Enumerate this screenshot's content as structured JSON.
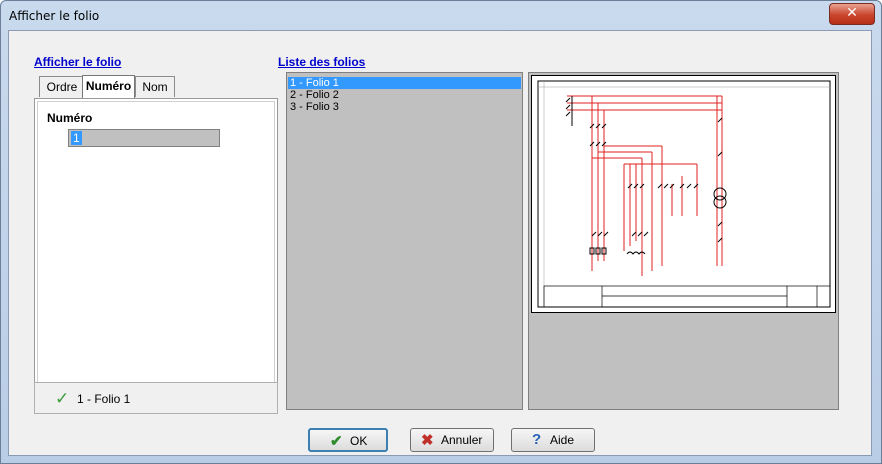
{
  "window": {
    "title": "Afficher le folio",
    "close_glyph": "✕"
  },
  "left": {
    "section_title": "Afficher le folio",
    "tabs": [
      {
        "label": "Ordre"
      },
      {
        "label": "Numéro"
      },
      {
        "label": "Nom"
      }
    ],
    "field_label": "Numéro",
    "field_value": "1",
    "status_text": "1 - Folio 1",
    "status_icon": "check-icon"
  },
  "list": {
    "section_title": "Liste des folios",
    "items": [
      {
        "label": "1 - Folio 1",
        "selected": true
      },
      {
        "label": "2 - Folio 2",
        "selected": false
      },
      {
        "label": "3 - Folio 3",
        "selected": false
      }
    ]
  },
  "buttons": {
    "ok": "OK",
    "cancel": "Annuler",
    "help": "Aide"
  },
  "colors": {
    "selection": "#3399ff",
    "link": "#0000cc",
    "wire_red": "#e02020",
    "ok_check": "#3a9c3a",
    "cancel_x": "#c0302a",
    "help_q": "#2a63b8"
  }
}
